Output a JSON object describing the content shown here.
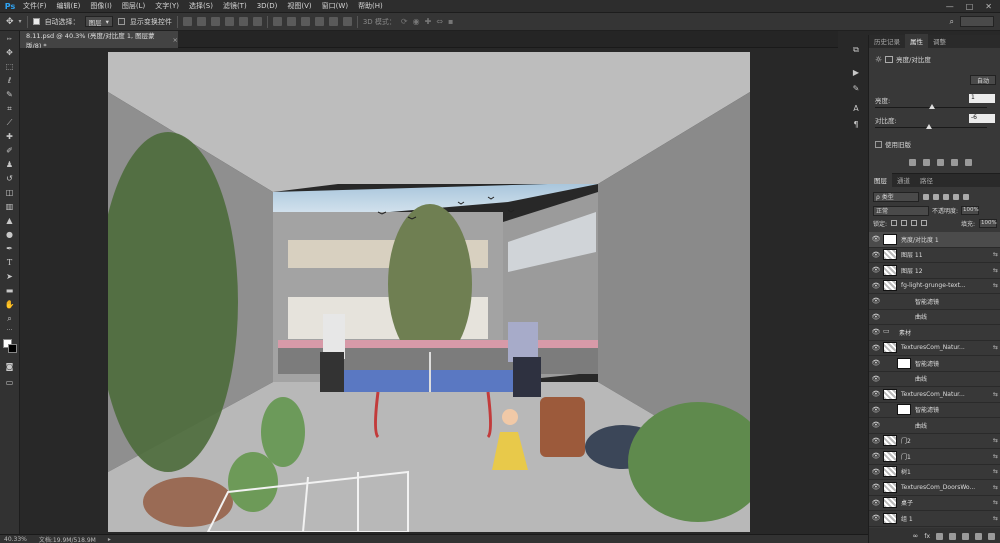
{
  "app": {
    "logo": "Ps"
  },
  "menu": [
    "文件(F)",
    "编辑(E)",
    "图像(I)",
    "图层(L)",
    "文字(Y)",
    "选择(S)",
    "滤镜(T)",
    "3D(D)",
    "视图(V)",
    "窗口(W)",
    "帮助(H)"
  ],
  "window_controls": {
    "minimize": "—",
    "maximize": "□",
    "close": "✕"
  },
  "options": {
    "auto_select_label": "自动选择：",
    "auto_select_value": "图层",
    "show_transform_label": "显示变换控件",
    "mode_3d_label": "3D 模式："
  },
  "document": {
    "tab_title": "8.11.psd @ 40.3% (亮度/对比度 1, 图层蒙版/8) *",
    "close": "×"
  },
  "status": {
    "zoom": "40.33%",
    "doc_size": "文档:19.9M/518.9M"
  },
  "properties": {
    "tabs": [
      "历史记录",
      "属性",
      "调整"
    ],
    "active_tab": 1,
    "title": "亮度/对比度",
    "auto_label": "自动",
    "brightness_label": "亮度:",
    "brightness_value": "1",
    "brightness_fraction": 0.505,
    "contrast_label": "对比度:",
    "contrast_value": "-6",
    "contrast_fraction": 0.48,
    "legacy_label": "使用旧版"
  },
  "layers": {
    "tabs": [
      "图层",
      "通道",
      "路径"
    ],
    "active_tab": 0,
    "kind_label": "ρ 类型",
    "blend_mode": "正常",
    "opacity_label": "不透明度:",
    "opacity_value": "100%",
    "lock_label": "锁定:",
    "fill_label": "填充:",
    "fill_value": "100%",
    "items": [
      {
        "name": "亮度/对比度 1",
        "thumb": "white",
        "selected": true,
        "sub": false
      },
      {
        "name": "图层 11",
        "thumb": "checker",
        "selected": false,
        "sub": false
      },
      {
        "name": "图层 12",
        "thumb": "checker",
        "selected": false,
        "sub": false
      },
      {
        "name": "fg-light-grunge-text...",
        "thumb": "checker",
        "selected": false,
        "sub": false
      },
      {
        "name": "智能滤镜",
        "thumb": "none",
        "selected": false,
        "sub": true
      },
      {
        "name": "曲线",
        "thumb": "none",
        "selected": false,
        "sub": true
      },
      {
        "name": "素材",
        "thumb": "folder",
        "selected": false,
        "sub": false
      },
      {
        "name": "TexturesCom_Natur...",
        "thumb": "checker",
        "selected": false,
        "sub": false
      },
      {
        "name": "智能滤镜",
        "thumb": "white",
        "selected": false,
        "sub": true
      },
      {
        "name": "曲线",
        "thumb": "none",
        "selected": false,
        "sub": true
      },
      {
        "name": "TexturesCom_Natur...",
        "thumb": "checker",
        "selected": false,
        "sub": false
      },
      {
        "name": "智能滤镜",
        "thumb": "white",
        "selected": false,
        "sub": true
      },
      {
        "name": "曲线",
        "thumb": "none",
        "selected": false,
        "sub": true
      },
      {
        "name": "门2",
        "thumb": "checker",
        "selected": false,
        "sub": false
      },
      {
        "name": "门1",
        "thumb": "checker",
        "selected": false,
        "sub": false
      },
      {
        "name": "树1",
        "thumb": "checker",
        "selected": false,
        "sub": false
      },
      {
        "name": "TexturesCom_DoorsWo...",
        "thumb": "checker",
        "selected": false,
        "sub": false
      },
      {
        "name": "桌子",
        "thumb": "checker",
        "selected": false,
        "sub": false
      },
      {
        "name": "组 1",
        "thumb": "checker",
        "selected": false,
        "sub": false
      }
    ]
  },
  "icons": {
    "eye": "👁",
    "link": "∞",
    "fx": "⇆"
  }
}
